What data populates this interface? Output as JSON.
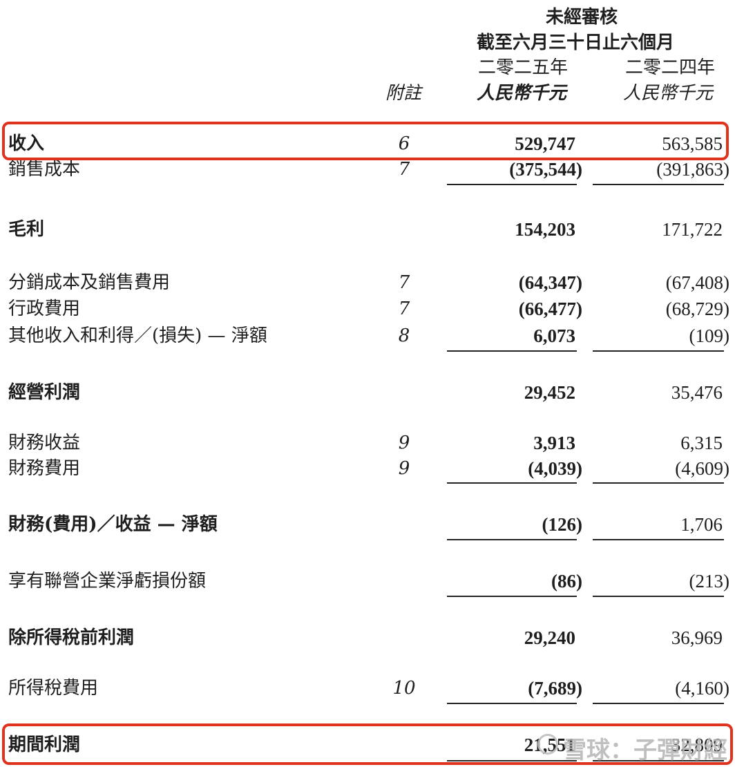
{
  "header": {
    "unaudited": "未經審核",
    "period": "截至六月三十日止六個月",
    "year_2025": "二零二五年",
    "year_2024": "二零二四年",
    "note_label": "附註",
    "currency_2025": "人民幣千元",
    "currency_2024": "人民幣千元"
  },
  "rows": [
    {
      "label": "收入",
      "note": "6",
      "v2025": "529,747",
      "v2024": "563,585"
    },
    {
      "label": "銷售成本",
      "note": "7",
      "v2025": "(375,544)",
      "v2024": "(391,863)"
    },
    {
      "label": "毛利",
      "note": "",
      "v2025": "154,203",
      "v2024": "171,722"
    },
    {
      "label": "分銷成本及銷售費用",
      "note": "7",
      "v2025": "(64,347)",
      "v2024": "(67,408)"
    },
    {
      "label": "行政費用",
      "note": "7",
      "v2025": "(66,477)",
      "v2024": "(68,729)"
    },
    {
      "label": "其他收入和利得／(損失) — 淨額",
      "note": "8",
      "v2025": "6,073",
      "v2024": "(109)"
    },
    {
      "label": "經營利潤",
      "note": "",
      "v2025": "29,452",
      "v2024": "35,476"
    },
    {
      "label": "財務收益",
      "note": "9",
      "v2025": "3,913",
      "v2024": "6,315"
    },
    {
      "label": "財務費用",
      "note": "9",
      "v2025": "(4,039)",
      "v2024": "(4,609)"
    },
    {
      "label": "財務(費用)／收益 — 淨額",
      "note": "",
      "v2025": "(126)",
      "v2024": "1,706"
    },
    {
      "label": "享有聯營企業淨虧損份額",
      "note": "",
      "v2025": "(86)",
      "v2024": "(213)"
    },
    {
      "label": "除所得稅前利潤",
      "note": "",
      "v2025": "29,240",
      "v2024": "36,969"
    },
    {
      "label": "所得稅費用",
      "note": "10",
      "v2025": "(7,689)",
      "v2024": "(4,160)"
    },
    {
      "label": "期間利潤",
      "note": "",
      "v2025": "21,551",
      "v2024": "32,809"
    }
  ],
  "watermark": {
    "text": "雪球：子彈財經"
  },
  "colors": {
    "highlight": "#e0331f",
    "text": "#1e1e1e"
  }
}
